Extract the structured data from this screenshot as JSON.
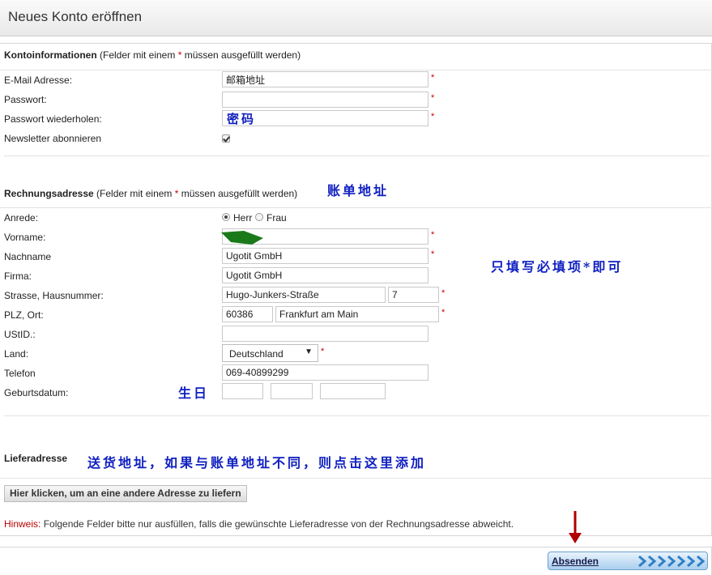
{
  "page": {
    "title": "Neues Konto eröffnen"
  },
  "account": {
    "heading": "Kontoinformationen",
    "note_prefix": " (Felder mit einem ",
    "note_star": "*",
    "note_suffix": " müssen ausgefüllt werden)",
    "email_label": "E-Mail Adresse:",
    "email_value": "邮箱地址",
    "password_label": "Passwort:",
    "password_value": "",
    "password_repeat_label": "Passwort wiederholen:",
    "password_repeat_value": "",
    "newsletter_label": "Newsletter abonnieren",
    "newsletter_checked": true
  },
  "billing": {
    "heading": "Rechnungsadresse",
    "note_prefix": " (Felder mit einem ",
    "note_star": "*",
    "note_suffix": " müssen ausgefüllt werden)",
    "salutation_label": "Anrede:",
    "salutation_options": [
      "Herr",
      "Frau"
    ],
    "salutation_selected": "Herr",
    "firstname_label": "Vorname:",
    "firstname_value": "",
    "lastname_label": "Nachname",
    "lastname_value": "Ugotit GmbH",
    "company_label": "Firma:",
    "company_value": "Ugotit GmbH",
    "street_label": "Strasse, Hausnummer:",
    "street_value": "Hugo-Junkers-Straße",
    "housenumber_value": "7",
    "zipcity_label": "PLZ, Ort:",
    "zip_value": "60386",
    "city_value": "Frankfurt am Main",
    "vatid_label": "UStID.:",
    "vatid_value": "",
    "country_label": "Land:",
    "country_value": "Deutschland",
    "phone_label": "Telefon",
    "phone_value": "069-40899299",
    "birthdate_label": "Geburtsdatum:",
    "birthdate_day": "",
    "birthdate_month": "",
    "birthdate_year": ""
  },
  "delivery": {
    "heading": "Lieferadresse",
    "button_label": "Hier klicken, um an eine andere Adresse zu liefern",
    "hint_key": "Hinweis:",
    "hint_text": " Folgende Felder bitte nur ausfüllen, falls die gewünschte Lieferadresse von der Rechnungsadresse abweicht."
  },
  "submit": {
    "label": "Absenden"
  },
  "annotations": {
    "password": "密码",
    "billing": "账单地址",
    "required_only": "只填写必填项*即可",
    "birthday": "生日",
    "delivery": "送货地址，如果与账单地址不同，则点击这里添加"
  },
  "colors": {
    "required": "#cc0000",
    "annotation": "#1020c0",
    "arrow": "#b00000",
    "button_blue": "#a9cfee"
  },
  "required_mark": "*"
}
